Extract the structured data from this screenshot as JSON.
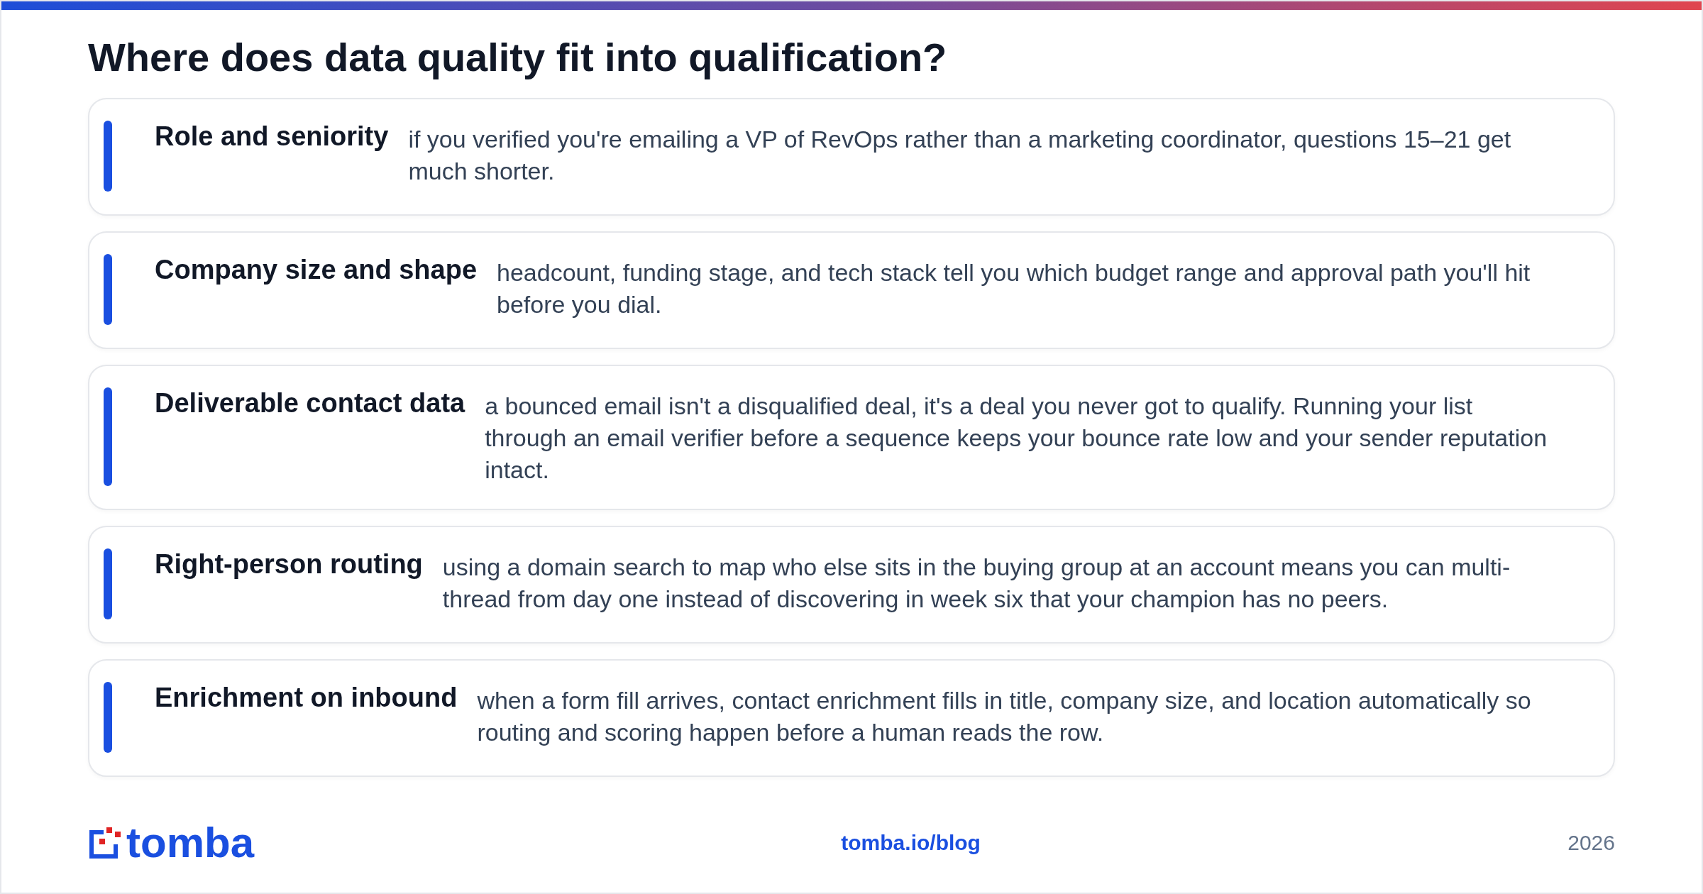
{
  "title": "Where does data quality fit into qualification?",
  "items": [
    {
      "term": "Role and seniority",
      "text": "if you verified you're emailing a VP of RevOps rather than a marketing coordinator, questions 15–21 get much shorter."
    },
    {
      "term": "Company size and shape",
      "text": "headcount, funding stage, and tech stack tell you which budget range and approval path you'll hit before you dial."
    },
    {
      "term": "Deliverable contact data",
      "text": "a bounced email isn't a disqualified deal, it's a deal you never got to qualify. Running your list through an email verifier before a sequence keeps your bounce rate low and your sender reputation intact."
    },
    {
      "term": "Right-person routing",
      "text": "using a domain search to map who else sits in the buying group at an account means you can multi-thread from day one instead of discovering in week six that your champion has no peers."
    },
    {
      "term": "Enrichment on inbound",
      "text": "when a form fill arrives, contact enrichment fills in title, company size, and location automatically so routing and scoring happen before a human reads the row."
    }
  ],
  "footer": {
    "logo": "tomba",
    "link": "tomba.io/blog",
    "year": "2026"
  }
}
